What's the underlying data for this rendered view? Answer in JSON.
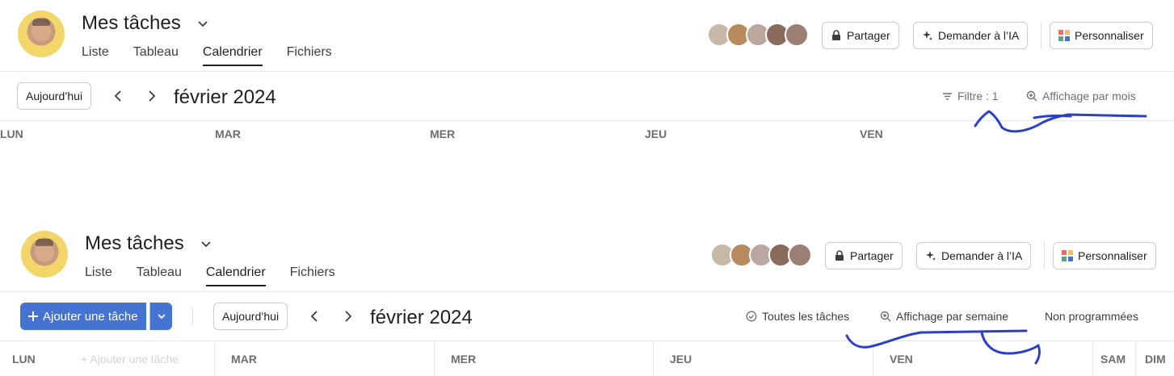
{
  "panel1": {
    "project": {
      "title": "Mes tâches"
    },
    "tabs": [
      "Liste",
      "Tableau",
      "Calendrier",
      "Fichiers"
    ],
    "active_tab": "Calendrier",
    "header_buttons": {
      "share": "Partager",
      "ask_ai": "Demander à l’IA",
      "customize": "Personnaliser"
    },
    "toolbar": {
      "today": "Aujourd’hui",
      "month": "février 2024",
      "filter": "Filtre : 1",
      "view": "Affichage par mois"
    },
    "days": [
      "LUN",
      "MAR",
      "MER",
      "JEU",
      "VEN"
    ]
  },
  "panel2": {
    "project": {
      "title": "Mes tâches"
    },
    "tabs": [
      "Liste",
      "Tableau",
      "Calendrier",
      "Fichiers"
    ],
    "active_tab": "Calendrier",
    "header_buttons": {
      "share": "Partager",
      "ask_ai": "Demander à l’IA",
      "customize": "Personnaliser"
    },
    "toolbar": {
      "add_task": "Ajouter une tâche",
      "today": "Aujourd’hui",
      "month": "février 2024",
      "all_tasks": "Toutes les tâches",
      "view": "Affichage par semaine",
      "unscheduled": "Non programmées"
    },
    "days": [
      "LUN",
      "MAR",
      "MER",
      "JEU",
      "VEN",
      "SAM",
      "DIM"
    ],
    "ghost_add": "Ajouter une tâche"
  },
  "colors": {
    "accent": "#4573d2",
    "annotation": "#2b3fc7",
    "member_avatars": [
      "#c7b8a8",
      "#b98a5e",
      "#b9a7a0",
      "#8a6a5a",
      "#9a7f72"
    ]
  },
  "icons": [
    "chevron-down-icon",
    "lock-icon",
    "sparkle-icon",
    "customize-grid-icon",
    "chevron-left-icon",
    "chevron-right-icon",
    "filter-icon",
    "zoom-icon",
    "check-circle-icon",
    "plus-icon"
  ]
}
